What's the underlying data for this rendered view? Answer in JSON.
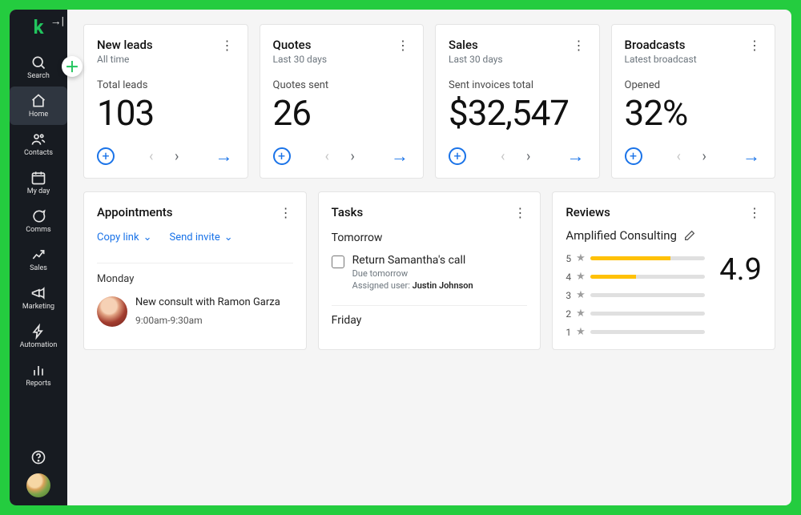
{
  "sidebar": {
    "items": [
      {
        "key": "search",
        "label": "Search"
      },
      {
        "key": "home",
        "label": "Home"
      },
      {
        "key": "contacts",
        "label": "Contacts"
      },
      {
        "key": "myday",
        "label": "My day"
      },
      {
        "key": "comms",
        "label": "Comms"
      },
      {
        "key": "sales",
        "label": "Sales"
      },
      {
        "key": "marketing",
        "label": "Marketing"
      },
      {
        "key": "automation",
        "label": "Automation"
      },
      {
        "key": "reports",
        "label": "Reports"
      }
    ]
  },
  "cards": {
    "leads": {
      "title": "New leads",
      "subtitle": "All time",
      "metric_label": "Total leads",
      "value": "103"
    },
    "quotes": {
      "title": "Quotes",
      "subtitle": "Last 30 days",
      "metric_label": "Quotes sent",
      "value": "26"
    },
    "sales": {
      "title": "Sales",
      "subtitle": "Last 30 days",
      "metric_label": "Sent invoices total",
      "value": "$32,547"
    },
    "broadcasts": {
      "title": "Broadcasts",
      "subtitle": "Latest broadcast",
      "metric_label": "Opened",
      "value": "32%"
    }
  },
  "appointments": {
    "title": "Appointments",
    "copy_link": "Copy link",
    "send_invite": "Send invite",
    "day_label": "Monday",
    "event_title": "New consult with Ramon Garza",
    "event_time": "9:00am-9:30am"
  },
  "tasks": {
    "title": "Tasks",
    "day1": "Tomorrow",
    "task1_title": "Return Samantha's call",
    "task1_due": "Due tomorrow",
    "assigned_label": "Assigned user:",
    "assignee": "Justin Johnson",
    "day2": "Friday"
  },
  "reviews": {
    "title": "Reviews",
    "company": "Amplified Consulting",
    "score": "4.9",
    "rows": [
      {
        "label": "5",
        "fill": 70
      },
      {
        "label": "4",
        "fill": 40
      },
      {
        "label": "3",
        "fill": 0
      },
      {
        "label": "2",
        "fill": 0
      },
      {
        "label": "1",
        "fill": 0
      }
    ]
  }
}
